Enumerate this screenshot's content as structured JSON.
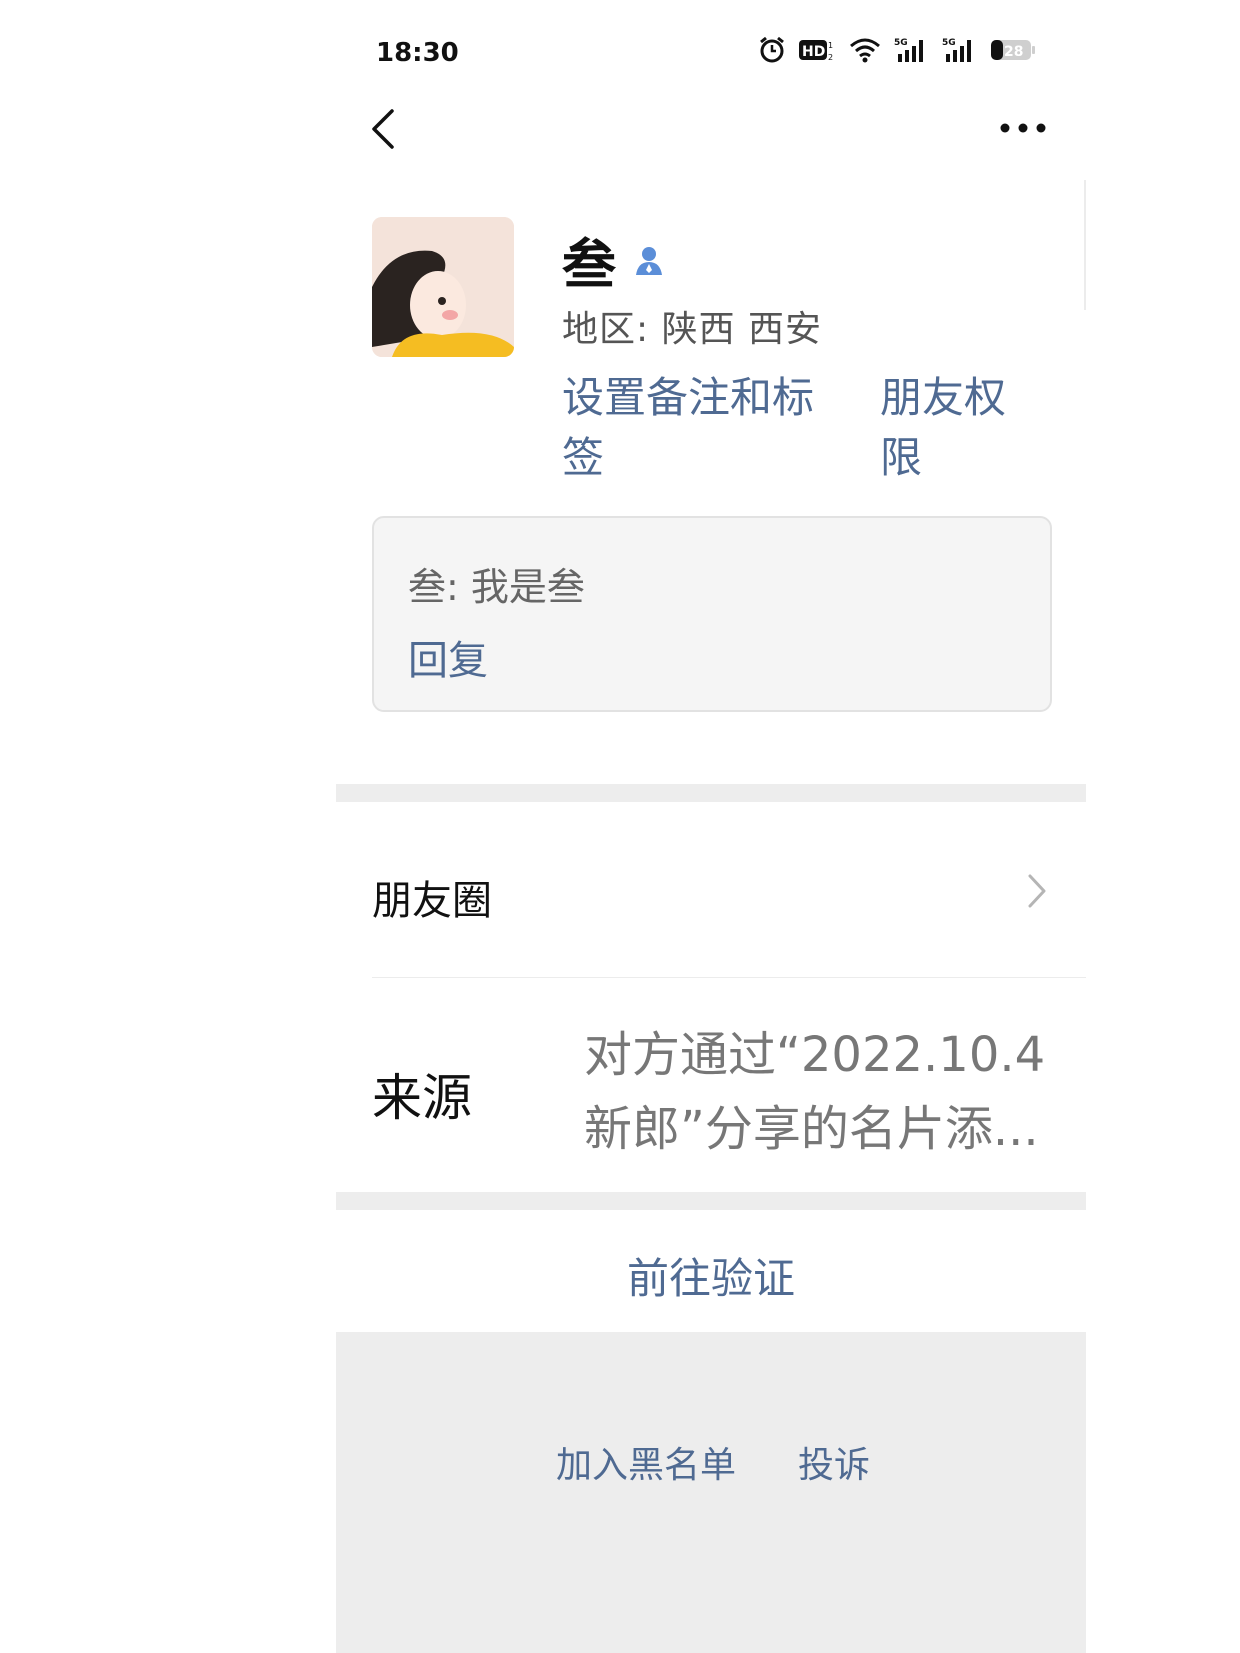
{
  "status_bar": {
    "time": "18:30",
    "battery": "28",
    "icons": [
      "alarm-icon",
      "hd-icon",
      "wifi-icon",
      "signal-5g-icon",
      "signal-5g-icon",
      "battery-icon"
    ]
  },
  "nav": {
    "back_icon": "chevron-left-icon",
    "more_icon": "more-icon"
  },
  "profile": {
    "name": "叁",
    "region": "地区:  陕西  西安",
    "remark_link": "设置备注和标签",
    "permission_link": "朋友权限"
  },
  "message": {
    "text": "叁: 我是叁",
    "reply_label": "回复"
  },
  "moments": {
    "label": "朋友圈"
  },
  "source": {
    "label": "来源",
    "value_line1": "对方通过“2022.10.4",
    "value_line2": "新郎”分享的名片添..."
  },
  "verify": {
    "label": "前往验证"
  },
  "footer": {
    "blacklist_label": "加入黑名单",
    "report_label": "投诉"
  },
  "colors": {
    "link": "#4f6a92",
    "separator": "#ededed",
    "message_bg": "#f5f5f5"
  }
}
